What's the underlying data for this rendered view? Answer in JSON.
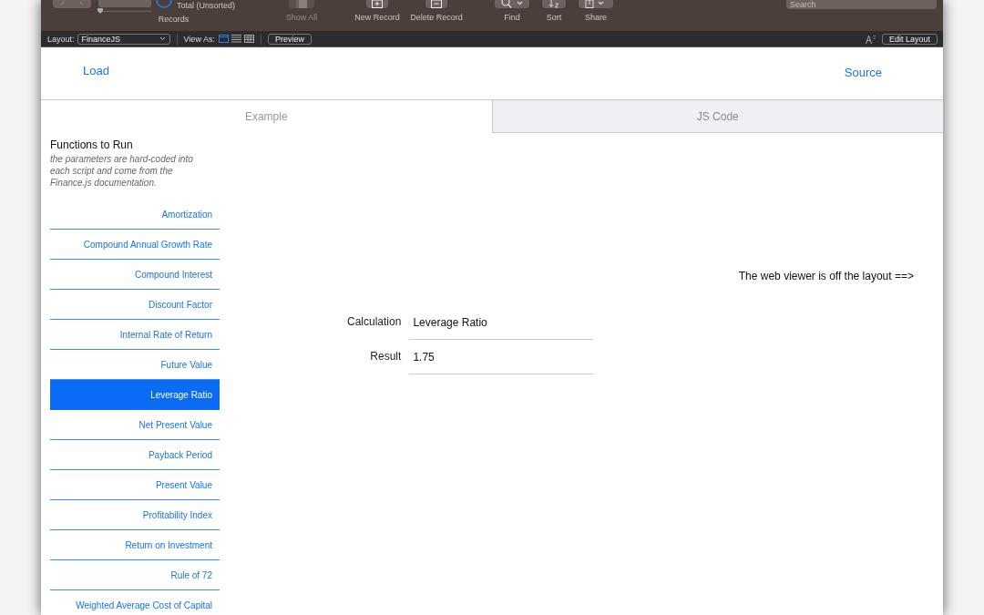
{
  "toolbar": {
    "record_slider": {
      "level": 0.03
    },
    "total": "Total (Unsorted)",
    "records_label": "Records",
    "buttons": [
      {
        "kind": "show-all",
        "label": "Show All",
        "disabled": true
      },
      {
        "kind": "new",
        "label": "New Record",
        "disabled": false
      },
      {
        "kind": "delete",
        "label": "Delete Record",
        "disabled": false
      },
      {
        "kind": "find",
        "label": "Find",
        "disabled": false
      },
      {
        "kind": "sort",
        "label": "Sort",
        "disabled": false
      },
      {
        "kind": "share",
        "label": "Share",
        "disabled": false
      }
    ],
    "search": {
      "placeholder": "Search"
    }
  },
  "layout_bar": {
    "layout_label": "Layout:",
    "layout": "FinanceJS",
    "view_as_label": "View As:",
    "views": [
      {
        "kind": "form",
        "selected": true
      },
      {
        "kind": "list",
        "selected": false
      },
      {
        "kind": "table",
        "selected": false
      }
    ],
    "preview": "Preview",
    "edit_layout": "Edit Layout"
  },
  "header": {
    "load": "Load",
    "source": "Source"
  },
  "tabs": [
    {
      "label": "Example",
      "selected": true
    },
    {
      "label": "JS Code",
      "selected": false
    }
  ],
  "sidebar": {
    "title": "Functions to Run",
    "note": "the parameters are hard-coded into each script and come from the Finance.js documentation.",
    "items": [
      {
        "label": "Amortization",
        "selected": false
      },
      {
        "label": "Compound Annual Growth Rate",
        "selected": false
      },
      {
        "label": "Compound Interest",
        "selected": false
      },
      {
        "label": "Discount Factor",
        "selected": false
      },
      {
        "label": "Internal Rate of Return",
        "selected": false
      },
      {
        "label": "Future Value",
        "selected": false
      },
      {
        "label": "Leverage Ratio",
        "selected": true
      },
      {
        "label": "Net Present Value",
        "selected": false
      },
      {
        "label": "Payback Period",
        "selected": false
      },
      {
        "label": "Present Value",
        "selected": false
      },
      {
        "label": "Profitability Index",
        "selected": false
      },
      {
        "label": "Return on Investment",
        "selected": false
      },
      {
        "label": "Rule of 72",
        "selected": false
      },
      {
        "label": "Weighted Average Cost of Capital",
        "selected": false
      }
    ]
  },
  "form": {
    "fields": [
      {
        "label": "Calculation",
        "value": "Leverage Ratio"
      },
      {
        "label": "Result",
        "value": "1.75"
      }
    ]
  },
  "web_viewer_note": "The web viewer is off the layout ==>"
}
